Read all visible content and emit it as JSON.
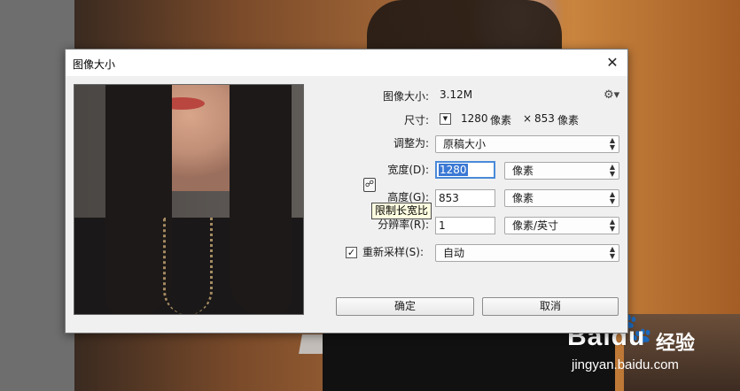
{
  "dialog": {
    "title": "图像大小",
    "close_glyph": "✕"
  },
  "image_size": {
    "label": "图像大小:",
    "value": "3.12M"
  },
  "dimensions": {
    "label": "尺寸:",
    "width_value": "1280",
    "width_unit": "像素",
    "times": "×",
    "height_value": "853",
    "height_unit": "像素"
  },
  "fit_to": {
    "label": "调整为:",
    "selected": "原稿大小"
  },
  "width": {
    "label": "宽度(D):",
    "value": "1280",
    "unit": "像素"
  },
  "height": {
    "label": "高度(G):",
    "value": "853",
    "unit": "像素"
  },
  "resolution": {
    "label": "分辨率(R):",
    "value": "1",
    "unit": "像素/英寸"
  },
  "resample": {
    "checked": true,
    "check_glyph": "✓",
    "label": "重新采样(S):",
    "selected": "自动"
  },
  "tooltip": {
    "text": "限制长宽比"
  },
  "buttons": {
    "ok": "确定",
    "cancel": "取消"
  },
  "icons": {
    "gear": "gear-icon",
    "link": "chain-link-icon",
    "dropdown": "chevron-down-icon",
    "dims_toggle": "triangle-down-icon"
  },
  "watermark": {
    "brand_logo": "Baidu",
    "brand_text": "经验",
    "url": "jingyan.baidu.com"
  }
}
